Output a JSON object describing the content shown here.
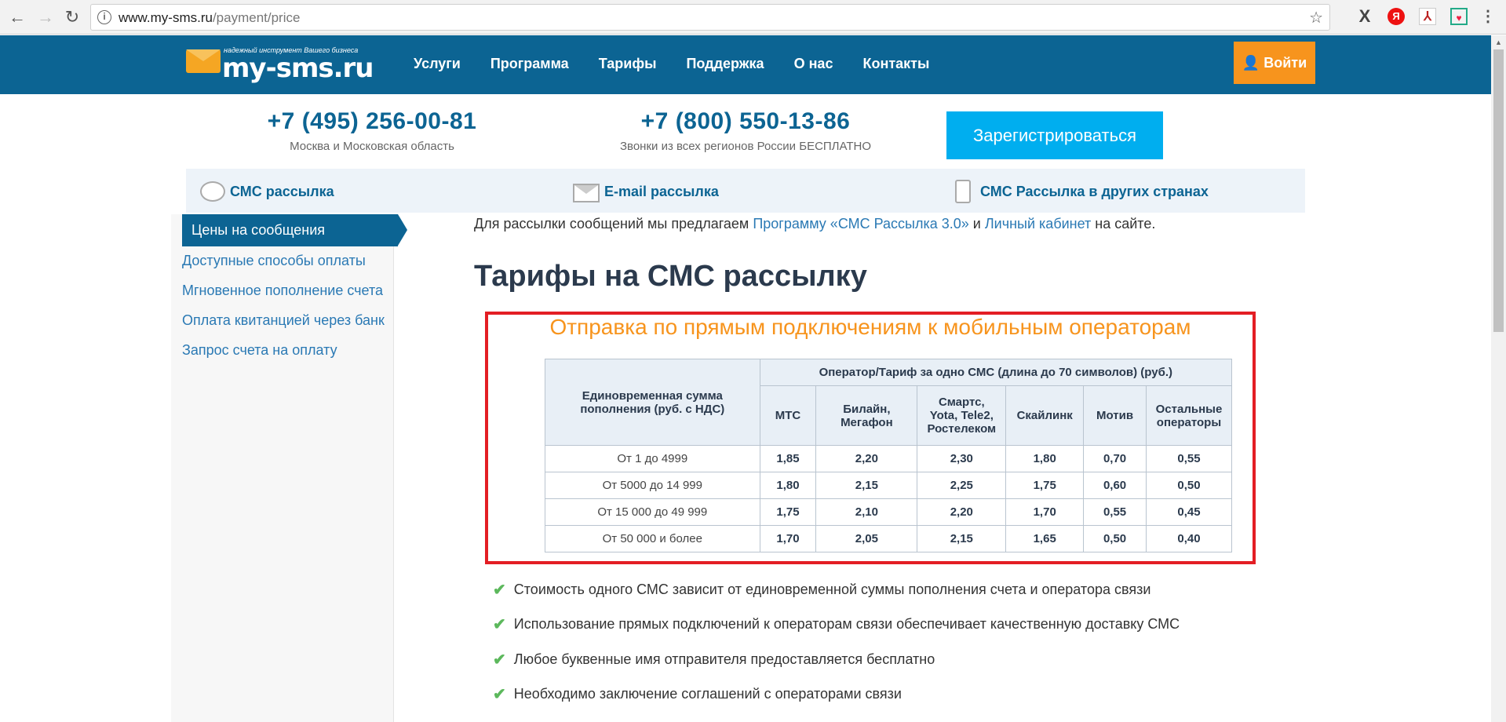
{
  "browser": {
    "url_domain": "www.my-sms.ru",
    "url_path": "/payment/price"
  },
  "header": {
    "logo_tagline": "надежный инструмент Вашего бизнеса",
    "logo_name": "my-sms.ru",
    "menu": [
      "Услуги",
      "Программа",
      "Тарифы",
      "Поддержка",
      "О нас",
      "Контакты"
    ],
    "login_label": "Войти"
  },
  "contacts": {
    "phone1": "+7 (495) 256-00-81",
    "phone1_note": "Москва и Московская область",
    "phone2": "+7 (800) 550-13-86",
    "phone2_note": "Звонки из всех регионов России БЕСПЛАТНО",
    "register_label": "Зарегистрироваться"
  },
  "services": [
    "СМС рассылка",
    "E-mail рассылка",
    "СМС Рассылка в других странах"
  ],
  "sidebar": {
    "active": "Цены на сообщения",
    "links": [
      "Доступные способы оплаты",
      "Мгновенное пополнение счета",
      "Оплата квитанцией через банк",
      "Запрос счета на оплату"
    ]
  },
  "main": {
    "intro_start": "Для рассылки сообщений мы предлагаем ",
    "intro_link1": "Программу «СМС Рассылка 3.0»",
    "intro_mid": " и ",
    "intro_link2": "Личный кабинет",
    "intro_end": " на сайте.",
    "title": "Тарифы на СМС рассылку",
    "frame_title": "Отправка по прямым подключениям к мобильным операторам",
    "table": {
      "col_sum_header": "Единовременная сумма пополнения (руб. с НДС)",
      "operator_header": "Оператор/Тариф за одно СМС (длина до 70 символов) (руб.)",
      "operators": [
        "МТС",
        "Билайн, Мегафон",
        "Смартс, Yota, Tele2, Ростелеком",
        "Скайлинк",
        "Мотив",
        "Остальные операторы"
      ],
      "rows": [
        {
          "range": "От 1 до 4999",
          "values": [
            "1,85",
            "2,20",
            "2,30",
            "1,80",
            "0,70",
            "0,55"
          ]
        },
        {
          "range": "От 5000 до 14 999",
          "values": [
            "1,80",
            "2,15",
            "2,25",
            "1,75",
            "0,60",
            "0,50"
          ]
        },
        {
          "range": "От 15 000 до 49 999",
          "values": [
            "1,75",
            "2,10",
            "2,20",
            "1,70",
            "0,55",
            "0,45"
          ]
        },
        {
          "range": "От 50 000 и более",
          "values": [
            "1,70",
            "2,05",
            "2,15",
            "1,65",
            "0,50",
            "0,40"
          ]
        }
      ]
    },
    "features": [
      "Стоимость одного СМС зависит от единовременной суммы пополнения счета и оператора связи",
      "Использование прямых подключений к операторам связи обеспечивает качественную доставку СМС",
      "Любое буквенные имя отправителя предоставляется бесплатно",
      "Необходимо заключение соглашений с операторами связи"
    ]
  },
  "colors": {
    "brand_blue": "#0c6493",
    "accent_orange": "#f7941d",
    "register_cyan": "#00aeef",
    "frame_red": "#e31e24"
  }
}
